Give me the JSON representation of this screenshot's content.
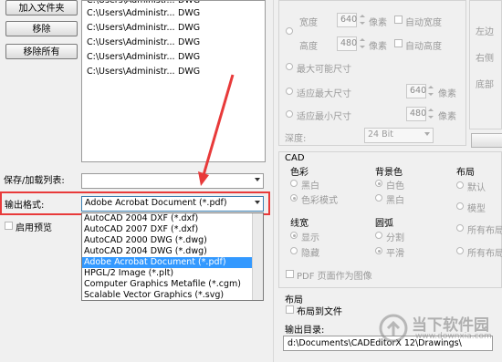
{
  "left": {
    "buttons": [
      "加入文件夹",
      "移除",
      "移除所有"
    ],
    "files": [
      {
        "path": "C:\\Users\\Administr...",
        "ext": "DWG"
      },
      {
        "path": "C:\\Users\\Administr...",
        "ext": "DWG"
      },
      {
        "path": "C:\\Users\\Administr...",
        "ext": "DWG"
      },
      {
        "path": "C:\\Users\\Administr...",
        "ext": "DWG"
      },
      {
        "path": "C:\\Users\\Administr...",
        "ext": "DWG"
      }
    ],
    "save_load_label": "保存/加载列表:",
    "output_format_label": "输出格式:",
    "output_format_value": "Adobe Acrobat Document (*.pdf)",
    "preview_label": "启用预览",
    "format_options": [
      "AutoCAD 2004 DXF (*.dxf)",
      "AutoCAD 2007 DXF (*.dxf)",
      "AutoCAD 2000 DWG (*.dwg)",
      "AutoCAD 2004 DWG (*.dwg)",
      "Adobe Acrobat Document (*.pdf)",
      "HPGL/2 Image (*.plt)",
      "Computer Graphics Metafile (*.cgm)",
      "Scalable Vector Graphics (*.svg)"
    ],
    "selected_index": 4
  },
  "right": {
    "width_label": "宽度",
    "width_value": "640",
    "width_unit": "像素",
    "auto_width": "自动宽度",
    "height_label": "高度",
    "height_value": "480",
    "height_unit": "像素",
    "auto_height": "自动高度",
    "max_size": "最大可能尺寸",
    "fit_max": "适应最大尺寸",
    "fit_max_value": "640",
    "fit_max_unit": "像素",
    "fit_min": "适应最小尺寸",
    "fit_min_value": "480",
    "fit_min_unit": "像素",
    "depth_label": "深度:",
    "depth_value": "24 Bit",
    "margin_left": "左边",
    "margin_right": "右侧",
    "margin_bottom": "底部",
    "cad_title": "CAD",
    "color_title": "色彩",
    "bw": "黑白",
    "color_mode": "色彩模式",
    "bg_title": "背景色",
    "white": "白色",
    "black": "黑白",
    "layout_title": "布局",
    "default": "默认",
    "model": "模型",
    "all_layouts1": "所有布局",
    "all_layouts2": "所有布局",
    "lineweight_title": "线宽",
    "show": "显示",
    "hide": "隐藏",
    "arc_title": "圆弧",
    "split": "分割",
    "smooth": "平滑",
    "pdf_image": "PDF 页面作为图像",
    "layout2_title": "布局",
    "layout_to_file": "布局到文件",
    "output_dir_label": "输出目录:",
    "output_dir_value": "d:\\Documents\\CADEditorX 12\\Drawings\\"
  },
  "watermark": {
    "text": "当下软件园",
    "url": "www.downxia.com"
  },
  "colors": {
    "highlight": "#3399ff",
    "annotation": "#e83a3a"
  }
}
